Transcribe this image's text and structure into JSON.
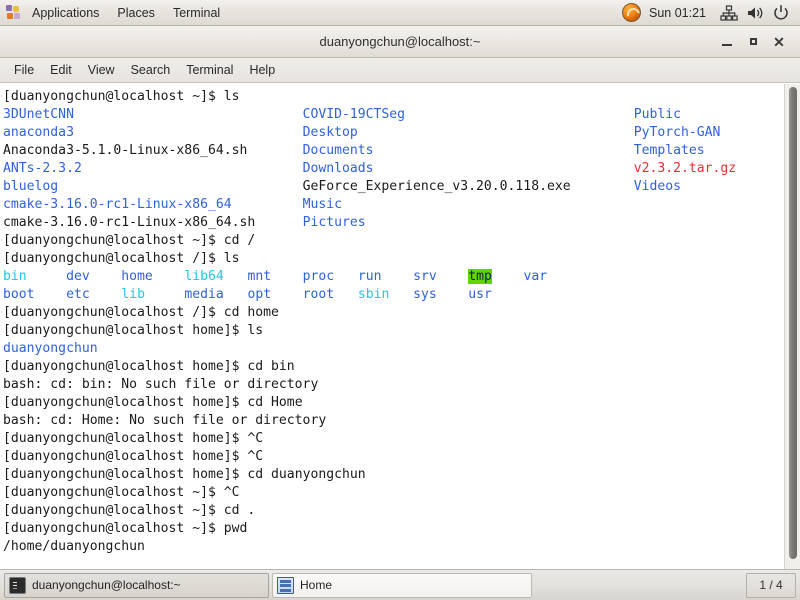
{
  "top_panel": {
    "apps_label": "Applications",
    "places_label": "Places",
    "terminal_label": "Terminal",
    "clock": "Sun 01:21",
    "icons": {
      "apps": "fedora-apps-icon",
      "browser": "firefox-icon",
      "network": "network-icon",
      "volume": "volume-icon",
      "power": "power-icon"
    }
  },
  "window": {
    "title": "duanyongchun@localhost:~",
    "buttons": {
      "minimize": "minimize-button",
      "maximize": "maximize-button",
      "close": "close-button"
    }
  },
  "menubar": {
    "items": [
      {
        "label": "File"
      },
      {
        "label": "Edit"
      },
      {
        "label": "View"
      },
      {
        "label": "Search"
      },
      {
        "label": "Terminal"
      },
      {
        "label": "Help"
      }
    ]
  },
  "terminal": {
    "prompt_home": "[duanyongchun@localhost ~]$ ",
    "prompt_root": "[duanyongchun@localhost /]$ ",
    "prompt_homedir": "[duanyongchun@localhost home]$ ",
    "colors": {
      "background": "#ffffff",
      "foreground": "#1a1a1a",
      "directory": "#2f62d8",
      "symlink": "#1ec8e0",
      "archive": "#e0312f",
      "sticky_bg": "#5fd600",
      "sticky_fg": "#10254f"
    },
    "lines": [
      {
        "type": "prompt",
        "prompt": "[duanyongchun@localhost ~]$ ",
        "command": "ls"
      },
      {
        "type": "cols",
        "cells": [
          {
            "text": "3DUnetCNN",
            "style": "dir"
          },
          {
            "text": "COVID-19CTSeg",
            "style": "dir"
          },
          {
            "text": "Public",
            "style": "dir"
          }
        ]
      },
      {
        "type": "cols",
        "cells": [
          {
            "text": "anaconda3",
            "style": "dir"
          },
          {
            "text": "Desktop",
            "style": "dir"
          },
          {
            "text": "PyTorch-GAN",
            "style": "dir"
          }
        ]
      },
      {
        "type": "cols",
        "cells": [
          {
            "text": "Anaconda3-5.1.0-Linux-x86_64.sh",
            "style": "plain"
          },
          {
            "text": "Documents",
            "style": "dir"
          },
          {
            "text": "Templates",
            "style": "dir"
          }
        ]
      },
      {
        "type": "cols",
        "cells": [
          {
            "text": "ANTs-2.3.2",
            "style": "dir"
          },
          {
            "text": "Downloads",
            "style": "dir"
          },
          {
            "text": "v2.3.2.tar.gz",
            "style": "arch"
          }
        ]
      },
      {
        "type": "cols",
        "cells": [
          {
            "text": "bluelog",
            "style": "dir"
          },
          {
            "text": "GeForce_Experience_v3.20.0.118.exe",
            "style": "plain"
          },
          {
            "text": "Videos",
            "style": "dir"
          }
        ]
      },
      {
        "type": "cols",
        "cells": [
          {
            "text": "cmake-3.16.0-rc1-Linux-x86_64",
            "style": "dir"
          },
          {
            "text": "Music",
            "style": "dir"
          },
          {
            "text": "",
            "style": "plain"
          }
        ]
      },
      {
        "type": "cols",
        "cells": [
          {
            "text": "cmake-3.16.0-rc1-Linux-x86_64.sh",
            "style": "plain"
          },
          {
            "text": "Pictures",
            "style": "dir"
          },
          {
            "text": "",
            "style": "plain"
          }
        ]
      },
      {
        "type": "prompt",
        "prompt": "[duanyongchun@localhost ~]$ ",
        "command": "cd /"
      },
      {
        "type": "prompt",
        "prompt": "[duanyongchun@localhost /]$ ",
        "command": "ls"
      },
      {
        "type": "rootls",
        "cells": [
          {
            "text": "bin",
            "style": "link",
            "width": 8
          },
          {
            "text": "dev",
            "style": "dir",
            "width": 7
          },
          {
            "text": "home",
            "style": "dir",
            "width": 8
          },
          {
            "text": "lib64",
            "style": "link",
            "width": 8
          },
          {
            "text": "mnt",
            "style": "dir",
            "width": 7
          },
          {
            "text": "proc",
            "style": "dir",
            "width": 7
          },
          {
            "text": "run",
            "style": "dir",
            "width": 7
          },
          {
            "text": "srv",
            "style": "dir",
            "width": 7
          },
          {
            "text": "tmp",
            "style": "sticky",
            "width": 7
          },
          {
            "text": "var",
            "style": "dir",
            "width": 5
          }
        ]
      },
      {
        "type": "rootls",
        "cells": [
          {
            "text": "boot",
            "style": "dir",
            "width": 8
          },
          {
            "text": "etc",
            "style": "dir",
            "width": 7
          },
          {
            "text": "lib",
            "style": "link",
            "width": 8
          },
          {
            "text": "media",
            "style": "dir",
            "width": 8
          },
          {
            "text": "opt",
            "style": "dir",
            "width": 7
          },
          {
            "text": "root",
            "style": "dir",
            "width": 7
          },
          {
            "text": "sbin",
            "style": "link",
            "width": 7
          },
          {
            "text": "sys",
            "style": "dir",
            "width": 7
          },
          {
            "text": "usr",
            "style": "dir",
            "width": 5
          }
        ]
      },
      {
        "type": "prompt",
        "prompt": "[duanyongchun@localhost /]$ ",
        "command": "cd home"
      },
      {
        "type": "prompt",
        "prompt": "[duanyongchun@localhost home]$ ",
        "command": "ls"
      },
      {
        "type": "out",
        "text": "duanyongchun",
        "style": "dir"
      },
      {
        "type": "prompt",
        "prompt": "[duanyongchun@localhost home]$ ",
        "command": "cd bin"
      },
      {
        "type": "out",
        "text": "bash: cd: bin: No such file or directory",
        "style": "plain"
      },
      {
        "type": "prompt",
        "prompt": "[duanyongchun@localhost home]$ ",
        "command": "cd Home"
      },
      {
        "type": "out",
        "text": "bash: cd: Home: No such file or directory",
        "style": "plain"
      },
      {
        "type": "prompt",
        "prompt": "[duanyongchun@localhost home]$ ",
        "command": "^C"
      },
      {
        "type": "prompt",
        "prompt": "[duanyongchun@localhost home]$ ",
        "command": "^C"
      },
      {
        "type": "prompt",
        "prompt": "[duanyongchun@localhost home]$ ",
        "command": "cd duanyongchun"
      },
      {
        "type": "prompt",
        "prompt": "[duanyongchun@localhost ~]$ ",
        "command": "^C"
      },
      {
        "type": "prompt",
        "prompt": "[duanyongchun@localhost ~]$ ",
        "command": "cd ."
      },
      {
        "type": "prompt",
        "prompt": "[duanyongchun@localhost ~]$ ",
        "command": "pwd"
      },
      {
        "type": "out",
        "text": "/home/duanyongchun",
        "style": "plain"
      }
    ]
  },
  "taskbar": {
    "windows": [
      {
        "label": "duanyongchun@localhost:~",
        "icon": "terminal-icon",
        "active": true
      },
      {
        "label": "Home",
        "icon": "file-manager-icon",
        "active": false
      }
    ],
    "workspace": "1 / 4"
  }
}
